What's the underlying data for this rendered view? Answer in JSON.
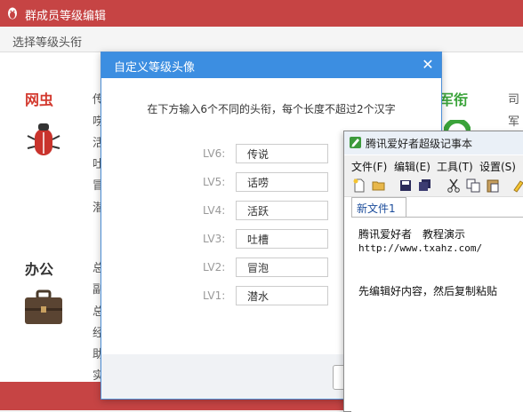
{
  "main_window": {
    "title": "群成员等级编辑",
    "toolbar_label": "选择等级头衔",
    "categories": [
      {
        "name": "网虫",
        "color": "#d33a2f",
        "lines": [
          "传",
          "唠",
          "活",
          "吐",
          "冒",
          "潜"
        ]
      },
      {
        "name": "办公",
        "color": "#333333",
        "lines": [
          "总",
          "副",
          "总",
          "经",
          "助",
          "实"
        ]
      },
      {
        "name": "军衔",
        "color": "#3aa33a",
        "lines": [
          "司",
          "军"
        ]
      }
    ]
  },
  "modal": {
    "title": "自定义等级头像",
    "instruction": "在下方输入6个不同的头衔，每个长度不超过2个汉字",
    "levels": [
      {
        "label": "LV6:",
        "value": "传说"
      },
      {
        "label": "LV5:",
        "value": "话唠"
      },
      {
        "label": "LV4:",
        "value": "活跃"
      },
      {
        "label": "LV3:",
        "value": "吐槽"
      },
      {
        "label": "LV2:",
        "value": "冒泡"
      },
      {
        "label": "LV1:",
        "value": "潜水"
      }
    ]
  },
  "notepad": {
    "title": "腾讯爱好者超级记事本",
    "menu": [
      "文件(F)",
      "编辑(E)",
      "工具(T)",
      "设置(S)"
    ],
    "tab": "新文件1",
    "lines": [
      "腾讯爱好者　教程演示",
      "http://www.txahz.com/",
      "",
      "先编辑好内容，然后复制粘贴"
    ]
  }
}
